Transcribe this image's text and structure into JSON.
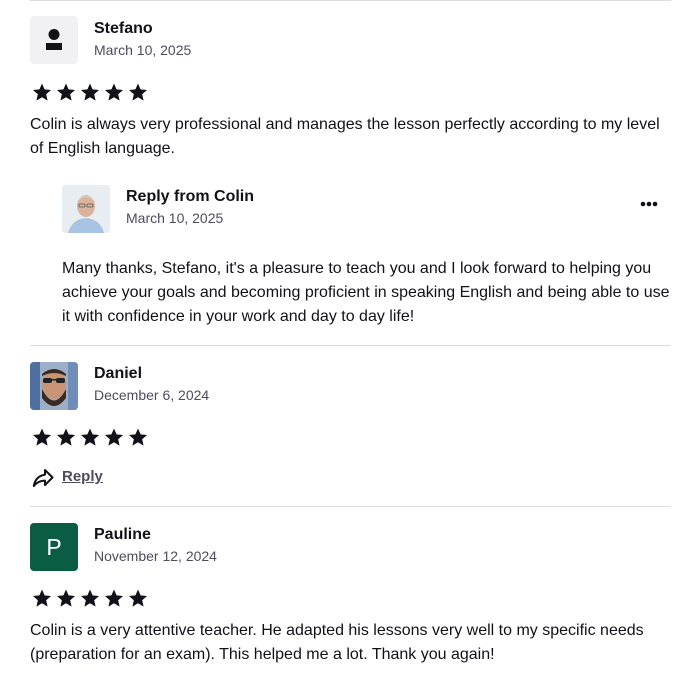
{
  "reviews": [
    {
      "name": "Stefano",
      "date": "March 10, 2025",
      "rating": 5,
      "text": "Colin is always very professional and manages the lesson perfectly according to my level of English language.",
      "reply": {
        "title": "Reply from Colin",
        "date": "March 10, 2025",
        "text": "Many thanks, Stefano, it's a pleasure to teach you and I look forward to helping you achieve your goals and becoming proficient in speaking English and being able to use it with confidence in your work and day to day life!"
      }
    },
    {
      "name": "Daniel",
      "date": "December 6, 2024",
      "rating": 5,
      "reply_label": "Reply"
    },
    {
      "name": "Pauline",
      "initial": "P",
      "avatar_color": "#0b5c45",
      "date": "November 12, 2024",
      "rating": 5,
      "text": "Colin is a very attentive teacher. He adapted his lessons very well to my specific needs (preparation for an exam). This helped me a lot. Thank you again!"
    }
  ],
  "icons": {
    "star": "star-icon",
    "more": "more-options-icon",
    "reply": "reply-arrow-icon",
    "user": "user-placeholder-icon"
  },
  "colors": {
    "text": "#121117",
    "muted": "#4d4c5c",
    "divider": "#dcdce5",
    "placeholder_bg": "#f1f1f3"
  }
}
